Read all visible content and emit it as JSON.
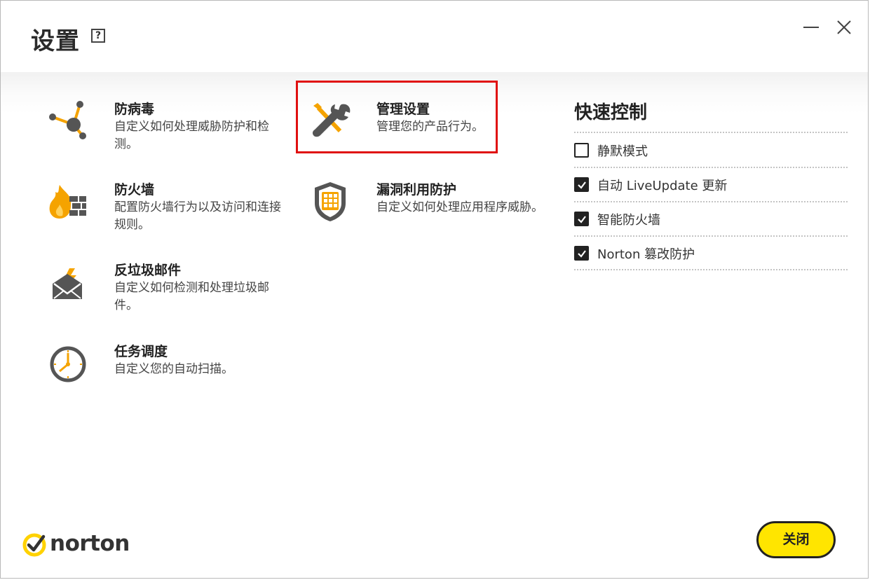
{
  "window": {
    "title": "设置",
    "help_label": "?"
  },
  "tiles": [
    {
      "name": "防病毒",
      "desc": "自定义如何处理威胁防护和检测。",
      "icon": "antivirus-network-icon"
    },
    {
      "name": "防火墙",
      "desc": "配置防火墙行为以及访问和连接规则。",
      "icon": "firewall-icon"
    },
    {
      "name": "反垃圾邮件",
      "desc": "自定义如何检测和处理垃圾邮件。",
      "icon": "antispam-envelope-icon"
    },
    {
      "name": "任务调度",
      "desc": "自定义您的自动扫描。",
      "icon": "clock-icon"
    },
    {
      "name": "管理设置",
      "desc": "管理您的产品行为。",
      "icon": "wrench-screwdriver-icon"
    },
    {
      "name": "漏洞利用防护",
      "desc": "自定义如何处理应用程序威胁。",
      "icon": "shield-grid-icon"
    }
  ],
  "quick_controls": {
    "title": "快速控制",
    "items": [
      {
        "label": "静默模式",
        "checked": false
      },
      {
        "label": "自动 LiveUpdate 更新",
        "checked": true
      },
      {
        "label": "智能防火墙",
        "checked": true
      },
      {
        "label": "Norton 篡改防护",
        "checked": true
      }
    ]
  },
  "footer": {
    "brand": "norton",
    "close_label": "关闭"
  },
  "colors": {
    "accent_yellow": "#ffe500",
    "icon_orange": "#f5a300",
    "icon_gray": "#555555",
    "selection_red": "#e01010"
  }
}
